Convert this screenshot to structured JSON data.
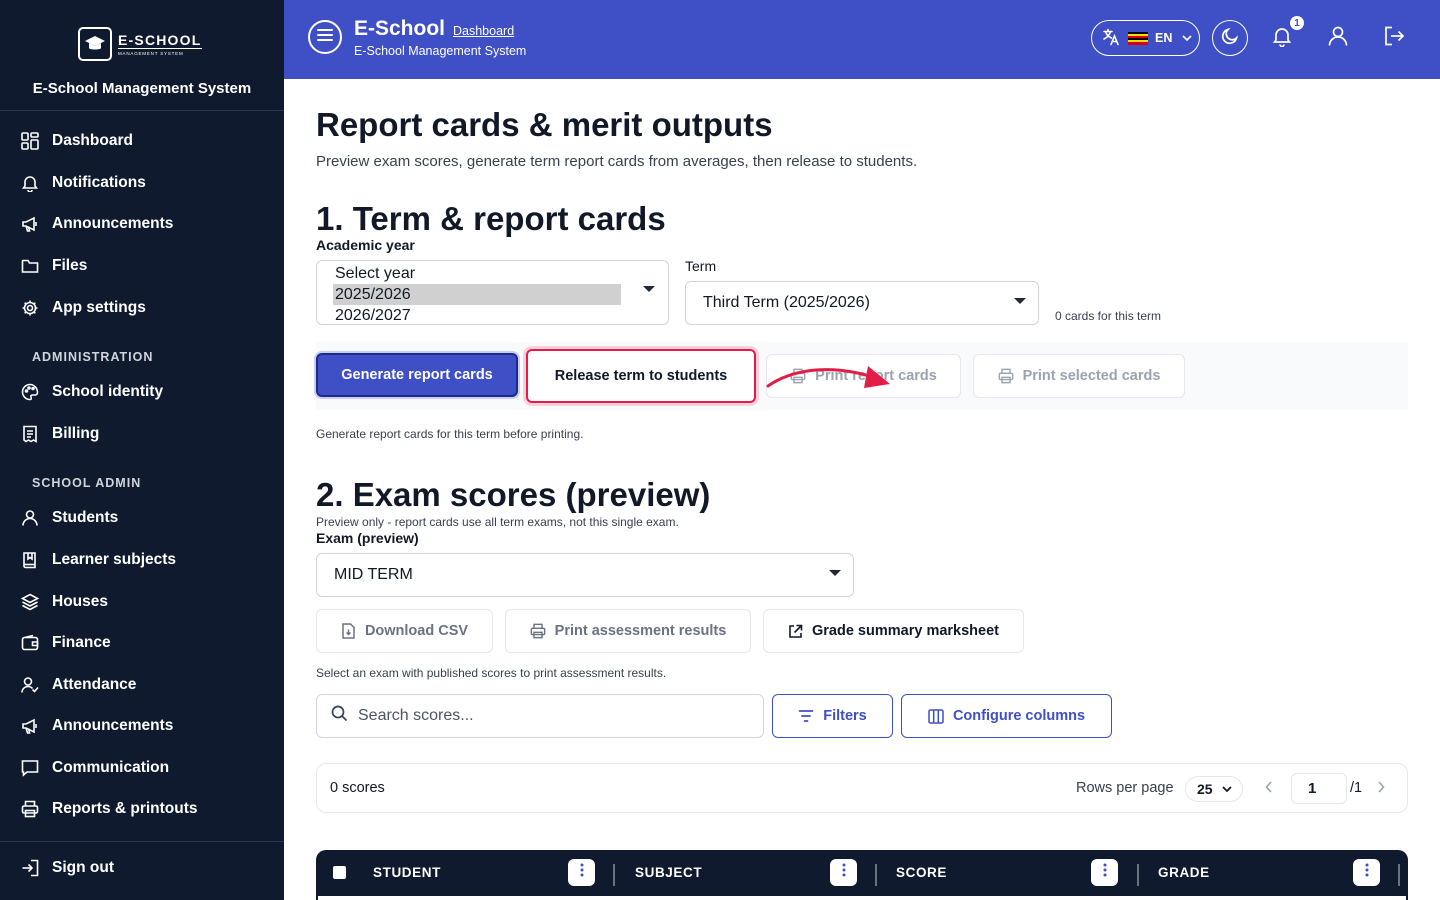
{
  "sidebar": {
    "logo_name": "E-SCHOOL",
    "logo_sub": "MANAGEMENT SYSTEM",
    "title": "E-School Management System",
    "items_top": [
      {
        "label": "Dashboard",
        "icon": "dashboard-icon"
      },
      {
        "label": "Notifications",
        "icon": "bell-icon"
      },
      {
        "label": "Announcements",
        "icon": "megaphone-icon"
      },
      {
        "label": "Files",
        "icon": "folder-icon"
      },
      {
        "label": "App settings",
        "icon": "gear-icon"
      }
    ],
    "section_admin": "ADMINISTRATION",
    "items_admin": [
      {
        "label": "School identity",
        "icon": "palette-icon"
      },
      {
        "label": "Billing",
        "icon": "receipt-icon"
      }
    ],
    "section_school": "SCHOOL ADMIN",
    "items_school": [
      {
        "label": "Students",
        "icon": "user-icon"
      },
      {
        "label": "Learner subjects",
        "icon": "book-icon"
      },
      {
        "label": "Houses",
        "icon": "layers-icon"
      },
      {
        "label": "Finance",
        "icon": "wallet-icon"
      },
      {
        "label": "Attendance",
        "icon": "user-check-icon"
      },
      {
        "label": "Announcements",
        "icon": "megaphone-icon"
      },
      {
        "label": "Communication",
        "icon": "chat-icon"
      },
      {
        "label": "Reports & printouts",
        "icon": "printer-icon"
      }
    ],
    "sign_out": "Sign out"
  },
  "header": {
    "brand": "E-School",
    "breadcrumb": "Dashboard",
    "subtitle": "E-School Management System",
    "language": "EN",
    "notification_count": "1"
  },
  "page": {
    "title": "Report cards & merit outputs",
    "description": "Preview exam scores, generate term report cards from averages, then release to students."
  },
  "section1": {
    "title": "1. Term & report cards",
    "year_label": "Academic year",
    "year_options": [
      "Select year",
      "2025/2026",
      "2026/2027"
    ],
    "year_selected": "2025/2026",
    "term_label": "Term",
    "term_value": "Third Term (2025/2026)",
    "cards_count": "0 cards for this term",
    "btn_generate": "Generate report cards",
    "btn_release": "Release term to students",
    "btn_print_cards": "Print report cards",
    "btn_print_selected": "Print selected cards",
    "hint": "Generate report cards for this term before printing."
  },
  "section2": {
    "title": "2. Exam scores (preview)",
    "note": "Preview only - report cards use all term exams, not this single exam.",
    "exam_label": "Exam (preview)",
    "exam_value": "MID TERM",
    "btn_csv": "Download CSV",
    "btn_print_results": "Print assessment results",
    "btn_marksheet": "Grade summary marksheet",
    "hint": "Select an exam with published scores to print assessment results.",
    "search_placeholder": "Search scores...",
    "btn_filters": "Filters",
    "btn_columns": "Configure columns",
    "scores_count": "0 scores",
    "rows_per_page_label": "Rows per page",
    "rows_per_page": "25",
    "page_current": "1",
    "page_total": "/1",
    "columns": [
      "STUDENT",
      "SUBJECT",
      "SCORE",
      "GRADE"
    ]
  },
  "colors": {
    "sidebar_bg": "#0f1a2e",
    "header_bg": "#3f4fc6",
    "accent": "#3f4fc6",
    "danger": "#e11d48"
  }
}
